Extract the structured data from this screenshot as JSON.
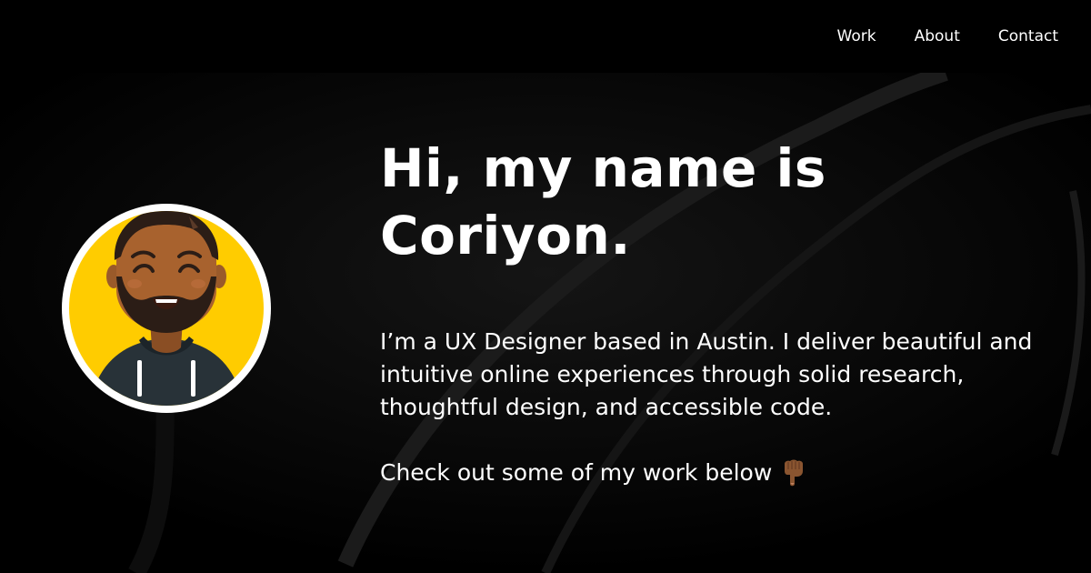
{
  "nav": {
    "items": [
      {
        "label": "Work"
      },
      {
        "label": "About"
      },
      {
        "label": "Contact"
      }
    ]
  },
  "hero": {
    "title_line1": "Hi, my name is",
    "title_line2": "Coriyon.",
    "bio": "I’m a UX Designer based in Austin. I deliver beautiful and intuitive online experiences through solid research, thoughtful design, and accessible code.",
    "cta": "Check out some of my work below",
    "cta_icon": "backhand-index-pointing-down-icon"
  },
  "avatar": {
    "icon": "avatar-illustration",
    "background_color": "#FFCC00",
    "ring_color": "#FFFFFF"
  },
  "colors": {
    "background": "#000000",
    "text": "#FFFFFF"
  }
}
